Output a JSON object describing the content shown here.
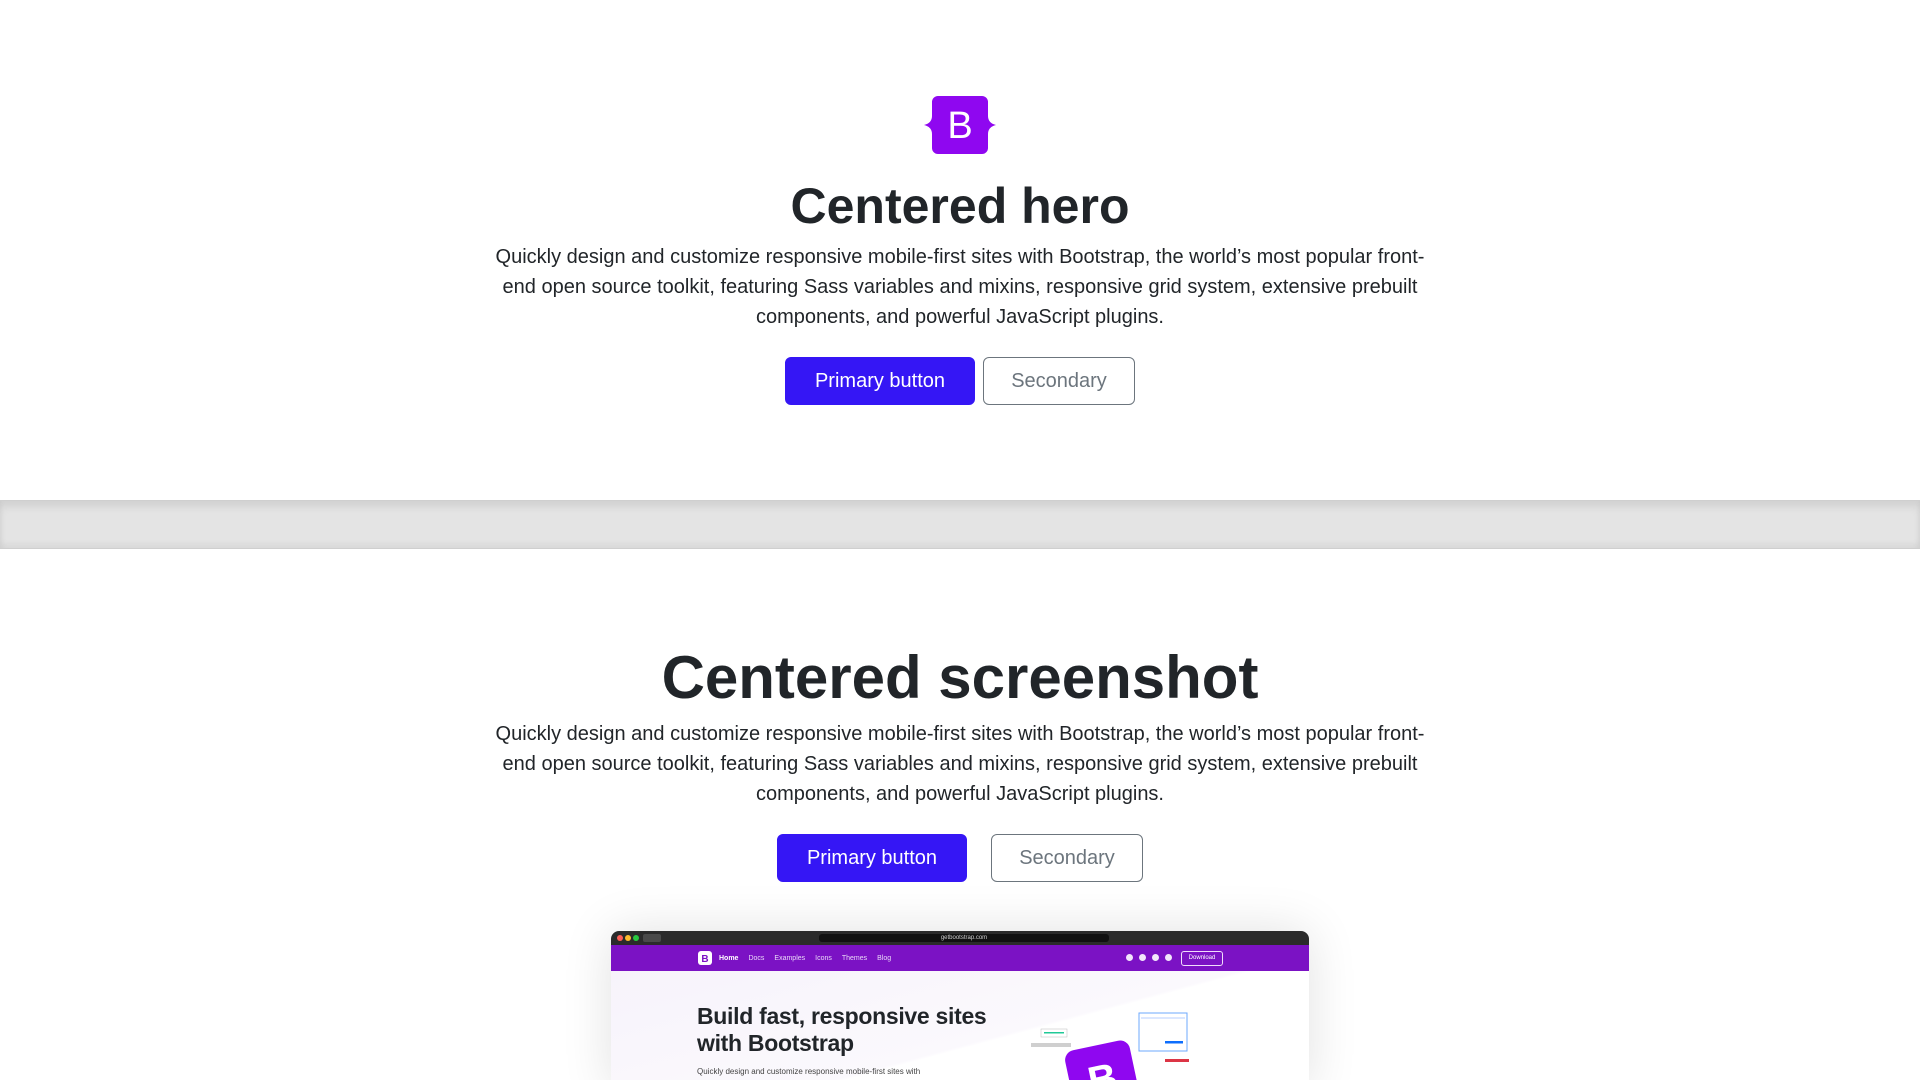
{
  "hero_centered": {
    "logo_letter": "B",
    "title": "Centered hero",
    "lead": "Quickly design and customize responsive mobile-first sites with Bootstrap, the world’s most popular front-end open source toolkit, featuring Sass variables and mixins, responsive grid system, extensive prebuilt components, and powerful JavaScript plugins.",
    "primary_button": "Primary button",
    "secondary_button": "Secondary"
  },
  "hero_screenshot": {
    "title": "Centered screenshot",
    "lead": "Quickly design and customize responsive mobile-first sites with Bootstrap, the world’s most popular front-end open source toolkit, featuring Sass variables and mixins, responsive grid system, extensive prebuilt components, and powerful JavaScript plugins.",
    "primary_button": "Primary button",
    "secondary_button": "Secondary",
    "preview": {
      "url": "getbootstrap.com",
      "nav_links": [
        "Home",
        "Docs",
        "Examples",
        "Icons",
        "Themes",
        "Blog"
      ],
      "download_label": "Download",
      "heading": "Build fast, responsive sites with Bootstrap",
      "body_text": "Quickly design and customize responsive mobile-first sites with"
    }
  },
  "colors": {
    "primary": "#3516f5",
    "secondary": "#6c757d",
    "brand_purple": "#7b12c4",
    "logo_purple": "#8f07f0"
  }
}
